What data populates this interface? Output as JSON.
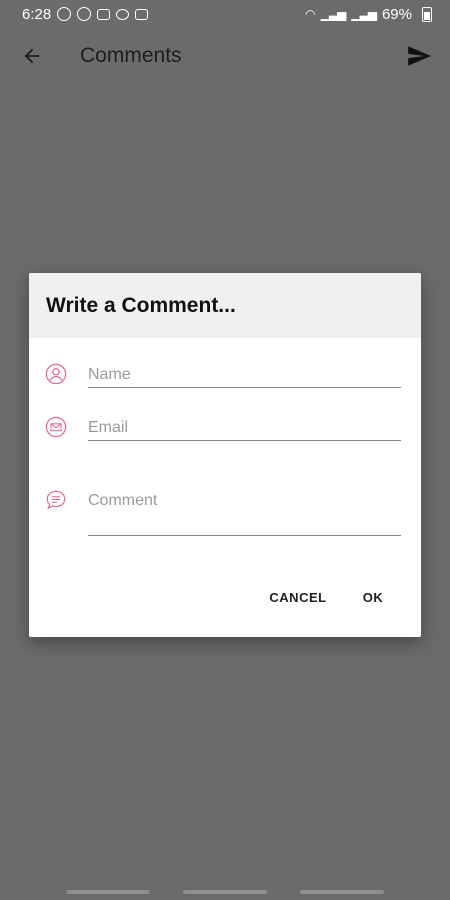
{
  "status_bar": {
    "time": "6:28",
    "battery_percent": "69%",
    "icons": [
      "b-icon",
      "whatsapp-icon",
      "gmail-icon",
      "link-icon",
      "gallery-icon",
      "wifi-icon",
      "volte-icon",
      "signal-icon",
      "signal-icon",
      "battery-icon"
    ]
  },
  "app_bar": {
    "title": "Comments",
    "back_icon": "arrow-left-icon",
    "send_icon": "send-icon"
  },
  "dialog": {
    "title": "Write a Comment...",
    "accent_color": "#e2688f",
    "fields": {
      "name": {
        "placeholder": "Name",
        "value": "",
        "icon": "user-icon"
      },
      "email": {
        "placeholder": "Email",
        "value": "",
        "icon": "email-icon"
      },
      "comment": {
        "placeholder": "Comment",
        "value": "",
        "icon": "chat-icon"
      }
    },
    "actions": {
      "cancel_label": "CANCEL",
      "ok_label": "OK"
    }
  },
  "colors": {
    "scrim": "#6b6b6b",
    "dialog_header": "#f0f0f0",
    "text_dark": "#1e1e1e"
  }
}
